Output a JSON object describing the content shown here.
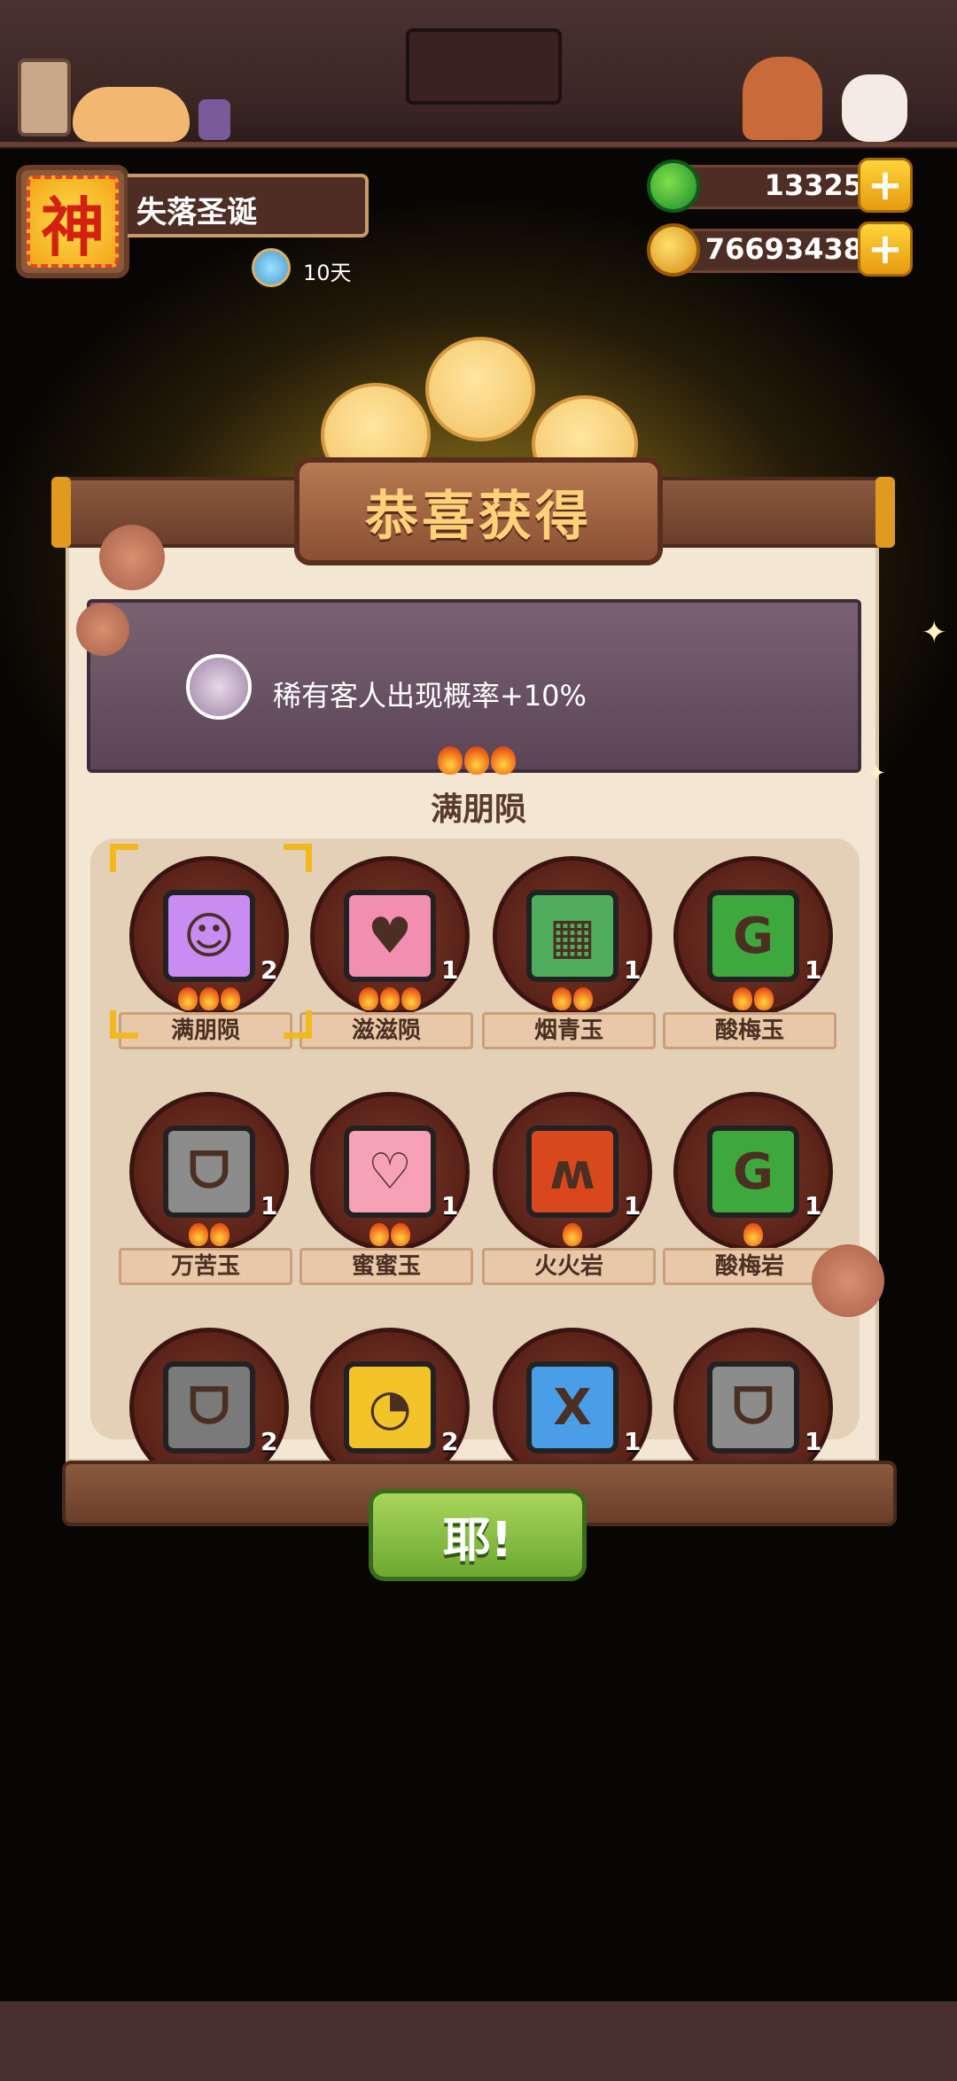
{
  "player": {
    "avatar_char": "神",
    "name": "失落圣诞",
    "days": "10天"
  },
  "currency": [
    {
      "icon": "jade-icon",
      "value": "13325"
    },
    {
      "icon": "coin-icon",
      "value": "76693438"
    }
  ],
  "popup": {
    "title": "恭喜获得",
    "buff_text": "稀有客人出现概率+10%",
    "series_name": "满朋陨",
    "confirm_label": "耶!"
  },
  "items": [
    {
      "name": "满朋陨",
      "count": "2",
      "stars": 3,
      "symbol": "☺",
      "color": "#c98cf2"
    },
    {
      "name": "滋滋陨",
      "count": "1",
      "stars": 3,
      "symbol": "♥",
      "color": "#f28fb0"
    },
    {
      "name": "烟青玉",
      "count": "1",
      "stars": 2,
      "symbol": "▦",
      "color": "#4fae5e"
    },
    {
      "name": "酸梅玉",
      "count": "1",
      "stars": 2,
      "symbol": "G",
      "color": "#3ea83e"
    },
    {
      "name": "万苦玉",
      "count": "1",
      "stars": 2,
      "symbol": "ᗜ",
      "color": "#8c8c8c"
    },
    {
      "name": "蜜蜜玉",
      "count": "1",
      "stars": 2,
      "symbol": "♡",
      "color": "#f7a1b6"
    },
    {
      "name": "火火岩",
      "count": "1",
      "stars": 1,
      "symbol": "ʍ",
      "color": "#d8481c"
    },
    {
      "name": "酸梅岩",
      "count": "1",
      "stars": 1,
      "symbol": "G",
      "color": "#3ea83e"
    },
    {
      "name": "",
      "count": "2",
      "stars": 0,
      "symbol": "ᗜ",
      "color": "#7a7a7a"
    },
    {
      "name": "",
      "count": "2",
      "stars": 0,
      "symbol": "◔",
      "color": "#f2c42a"
    },
    {
      "name": "",
      "count": "1",
      "stars": 0,
      "symbol": "ꓫ",
      "color": "#4a9ee8"
    },
    {
      "name": "",
      "count": "1",
      "stars": 0,
      "symbol": "ᗜ",
      "color": "#8c8c8c"
    }
  ]
}
